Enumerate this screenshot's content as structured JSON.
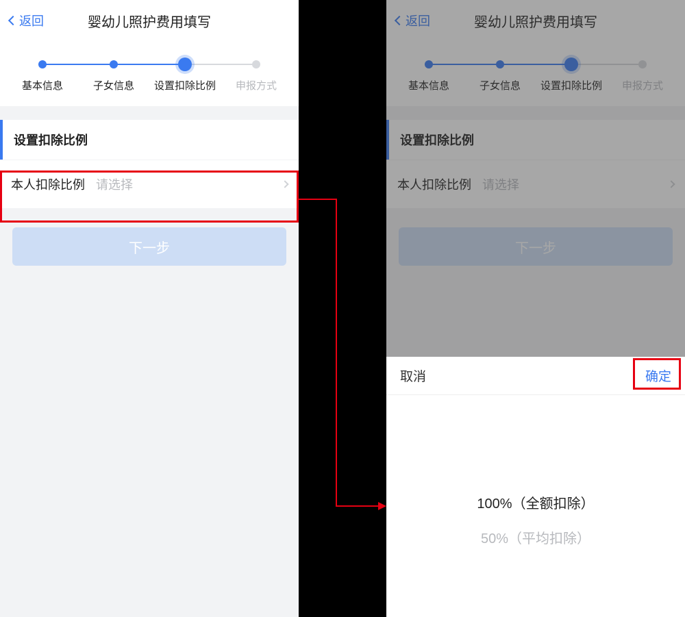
{
  "header": {
    "back_label": "返回",
    "title": "婴幼儿照护费用填写"
  },
  "steps": [
    {
      "label": "基本信息",
      "state": "done"
    },
    {
      "label": "子女信息",
      "state": "done"
    },
    {
      "label": "设置扣除比例",
      "state": "active"
    },
    {
      "label": "申报方式",
      "state": "pending"
    }
  ],
  "section": {
    "title": "设置扣除比例",
    "row_label": "本人扣除比例",
    "row_placeholder": "请选择"
  },
  "button": {
    "next_label": "下一步"
  },
  "picker": {
    "cancel_label": "取消",
    "confirm_label": "确定",
    "options": [
      {
        "label": "100%（全额扣除）",
        "selected": true
      },
      {
        "label": "50%（平均扣除）",
        "selected": false
      }
    ]
  }
}
